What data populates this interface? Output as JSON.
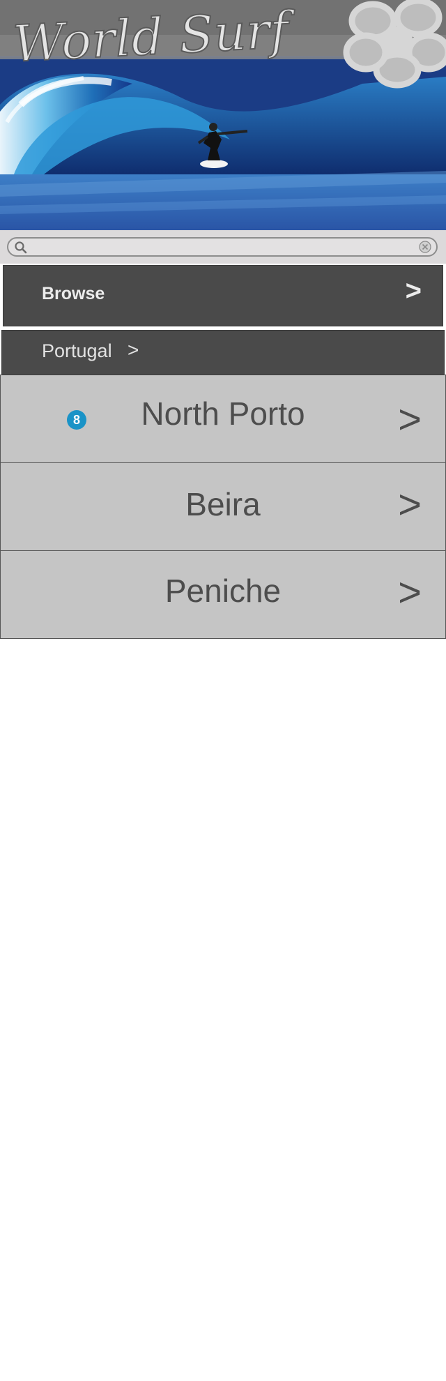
{
  "header": {
    "logo_text": "World Surf",
    "colors": {
      "sky": "#7a7a7a",
      "ocean": "#1d3f8d",
      "wave": "#5fb3e6",
      "flower": "#d8d8d8"
    }
  },
  "search": {
    "value": "",
    "placeholder": "",
    "icon": "search-icon",
    "clear_icon": "clear-icon"
  },
  "browse": {
    "label": "Browse",
    "chevron": ">"
  },
  "breadcrumb": {
    "label": "Portugal",
    "chevron": ">"
  },
  "regions": [
    {
      "name": "North Porto",
      "badge": "8",
      "chevron": ">"
    },
    {
      "name": "Beira",
      "chevron": ">"
    },
    {
      "name": "Peniche",
      "chevron": ">"
    }
  ],
  "colors": {
    "bar_bg": "#4a4a4a",
    "list_bg": "#c5c5c5",
    "badge_bg": "#1a93c7",
    "text_dark": "#4d4d4d"
  }
}
